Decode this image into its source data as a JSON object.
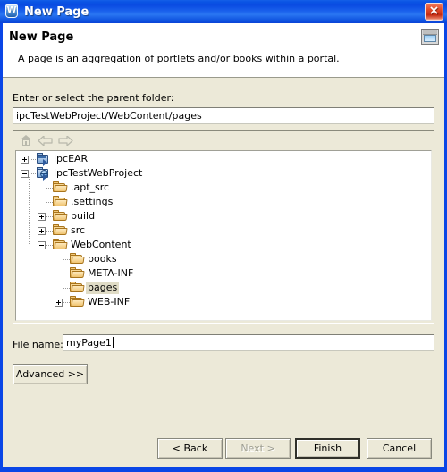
{
  "window": {
    "title": "New Page",
    "icon": "workshop-w-icon",
    "close_label": "×"
  },
  "header": {
    "title": "New Page",
    "description": "A page is an aggregation of portlets and/or books within a portal.",
    "icon": "new-page-wizard-icon"
  },
  "form": {
    "parent_folder_label": "Enter or select the parent folder:",
    "parent_folder_value": "ipcTestWebProject/WebContent/pages",
    "file_name_label": "File name:",
    "file_name_value": "myPage1",
    "advanced_label": "Advanced >>"
  },
  "tree_toolbar": {
    "home_title": "Home",
    "back_title": "Back",
    "forward_title": "Forward"
  },
  "tree": {
    "selected": "pages",
    "nodes": [
      {
        "label": "ipcEAR",
        "depth": 0,
        "icon": "project-icon",
        "twisty": "plus",
        "selected": false
      },
      {
        "label": "ipcTestWebProject",
        "depth": 0,
        "icon": "web-project-icon",
        "twisty": "minus",
        "selected": false
      },
      {
        "label": ".apt_src",
        "depth": 1,
        "icon": "folder-icon",
        "twisty": "none",
        "selected": false
      },
      {
        "label": ".settings",
        "depth": 1,
        "icon": "folder-icon",
        "twisty": "none",
        "selected": false
      },
      {
        "label": "build",
        "depth": 1,
        "icon": "folder-icon",
        "twisty": "plus",
        "selected": false
      },
      {
        "label": "src",
        "depth": 1,
        "icon": "folder-icon",
        "twisty": "plus",
        "selected": false
      },
      {
        "label": "WebContent",
        "depth": 1,
        "icon": "folder-icon",
        "twisty": "minus",
        "selected": false
      },
      {
        "label": "books",
        "depth": 2,
        "icon": "folder-icon",
        "twisty": "none",
        "selected": false
      },
      {
        "label": "META-INF",
        "depth": 2,
        "icon": "folder-icon",
        "twisty": "none",
        "selected": false
      },
      {
        "label": "pages",
        "depth": 2,
        "icon": "folder-icon",
        "twisty": "none",
        "selected": true
      },
      {
        "label": "WEB-INF",
        "depth": 2,
        "icon": "folder-icon",
        "twisty": "plus",
        "selected": false
      }
    ]
  },
  "footer": {
    "back_label": "< Back",
    "next_label": "Next >",
    "finish_label": "Finish",
    "cancel_label": "Cancel",
    "next_enabled": false,
    "default_button": "Finish"
  },
  "colors": {
    "titlebar_blue": "#0A46E6",
    "dialog_face": "#ECE9D8",
    "selection": "#E0DCC6",
    "close_red": "#C42B12"
  }
}
